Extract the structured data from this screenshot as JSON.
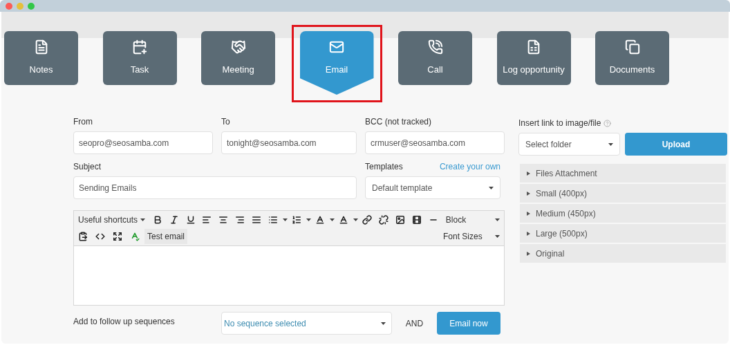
{
  "tabs": [
    {
      "label": "Notes",
      "kind": "notes",
      "selected": false,
      "highlighted": false
    },
    {
      "label": "Task",
      "kind": "task",
      "selected": false,
      "highlighted": false
    },
    {
      "label": "Meeting",
      "kind": "meeting",
      "selected": false,
      "highlighted": false
    },
    {
      "label": "Email",
      "kind": "email",
      "selected": true,
      "highlighted": true
    },
    {
      "label": "Call",
      "kind": "call",
      "selected": false,
      "highlighted": false
    },
    {
      "label": "Log opportunity",
      "kind": "opportunity",
      "selected": false,
      "highlighted": false
    },
    {
      "label": "Documents",
      "kind": "documents",
      "selected": false,
      "highlighted": false
    }
  ],
  "fields": [
    {
      "label": "From",
      "value": "seopro@seosamba.com"
    },
    {
      "label": "To",
      "value": "tonight@seosamba.com"
    },
    {
      "label": "BCC (not tracked)",
      "value": "crmuser@seosamba.com"
    }
  ],
  "subject": {
    "label": "Subject",
    "value": "Sending Emails"
  },
  "templates": {
    "label": "Templates",
    "link": "Create your own",
    "value": "Default template"
  },
  "editor": {
    "shortcuts": "Useful shortcuts",
    "block": "Block",
    "font_sizes": "Font Sizes",
    "test_button": "Test email"
  },
  "follow_up": {
    "label": "Add to follow up sequences",
    "value": "No sequence selected",
    "joiner": "AND",
    "button": "Email now"
  },
  "insert": {
    "label": "Insert link to image/file",
    "folder": "Select folder",
    "upload": "Upload"
  },
  "sections": [
    {
      "label": "Files Attachment",
      "expanded": false
    },
    {
      "label": "Small (400px)",
      "expanded": false
    },
    {
      "label": "Medium (450px)",
      "expanded": false
    },
    {
      "label": "Large (500px)",
      "expanded": false
    },
    {
      "label": "Original",
      "expanded": false
    }
  ]
}
